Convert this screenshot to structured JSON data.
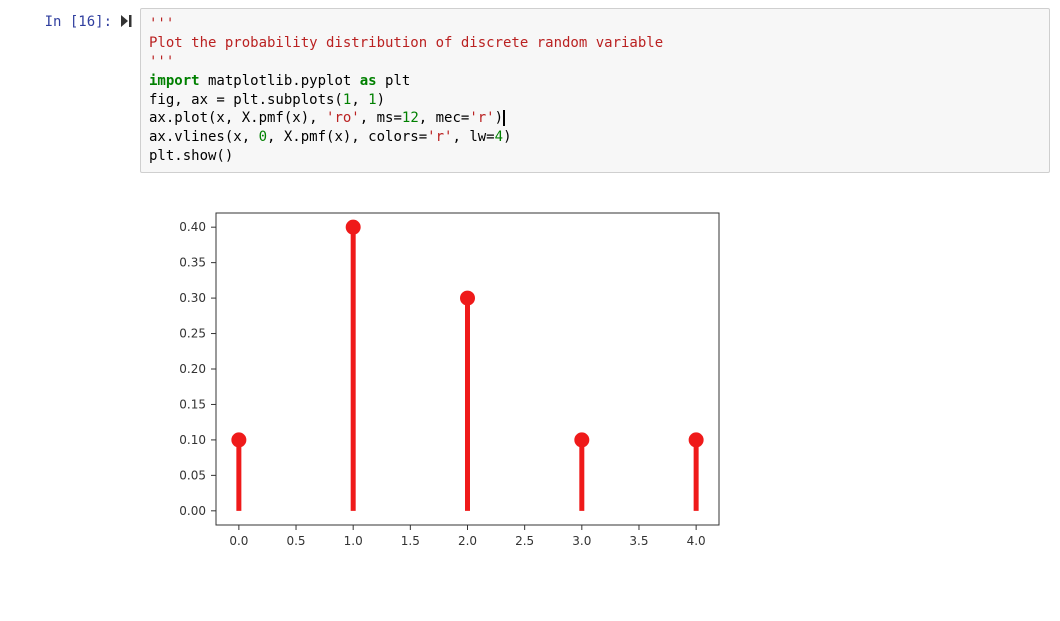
{
  "cell": {
    "prompt_label": "In [16]:",
    "run_icon": "step-forward-icon",
    "code": {
      "docstring_open": "'''",
      "docstring_line": "Plot the probability distribution of discrete random variable",
      "docstring_close": "'''",
      "import_kw": "import",
      "mod": " matplotlib.pyplot ",
      "as_kw": "as",
      "alias": " plt",
      "line2_a": "fig, ax = plt.subplots(",
      "line2_n1": "1",
      "line2_c": ", ",
      "line2_n2": "1",
      "line2_b": ")",
      "line3_a": "ax.plot(x, X.pmf(x), ",
      "line3_s1": "'ro'",
      "line3_b": ", ms=",
      "line3_n1": "12",
      "line3_c": ", mec=",
      "line3_s2": "'r'",
      "line3_d": ")",
      "line4_a": "ax.vlines(x, ",
      "line4_n0": "0",
      "line4_b": ", X.pmf(x), colors=",
      "line4_s1": "'r'",
      "line4_c": ", lw=",
      "line4_n1": "4",
      "line4_d": ")",
      "line5": "plt.show()"
    }
  },
  "chart_data": {
    "type": "bar",
    "categories": [
      0,
      1,
      2,
      3,
      4
    ],
    "values": [
      0.1,
      0.4,
      0.3,
      0.1,
      0.1
    ],
    "title": "",
    "xlabel": "",
    "ylabel": "",
    "xlim": [
      -0.2,
      4.2
    ],
    "ylim": [
      -0.02,
      0.42
    ],
    "yticks": [
      0.0,
      0.05,
      0.1,
      0.15,
      0.2,
      0.25,
      0.3,
      0.35,
      0.4
    ],
    "ytick_labels": [
      "0.00",
      "0.05",
      "0.10",
      "0.15",
      "0.20",
      "0.25",
      "0.30",
      "0.35",
      "0.40"
    ],
    "xticks": [
      0.0,
      0.5,
      1.0,
      1.5,
      2.0,
      2.5,
      3.0,
      3.5,
      4.0
    ],
    "xtick_labels": [
      "0.0",
      "0.5",
      "1.0",
      "1.5",
      "2.0",
      "2.5",
      "3.0",
      "3.5",
      "4.0"
    ],
    "series_color": "#ef1a1a",
    "marker_size": 7
  }
}
